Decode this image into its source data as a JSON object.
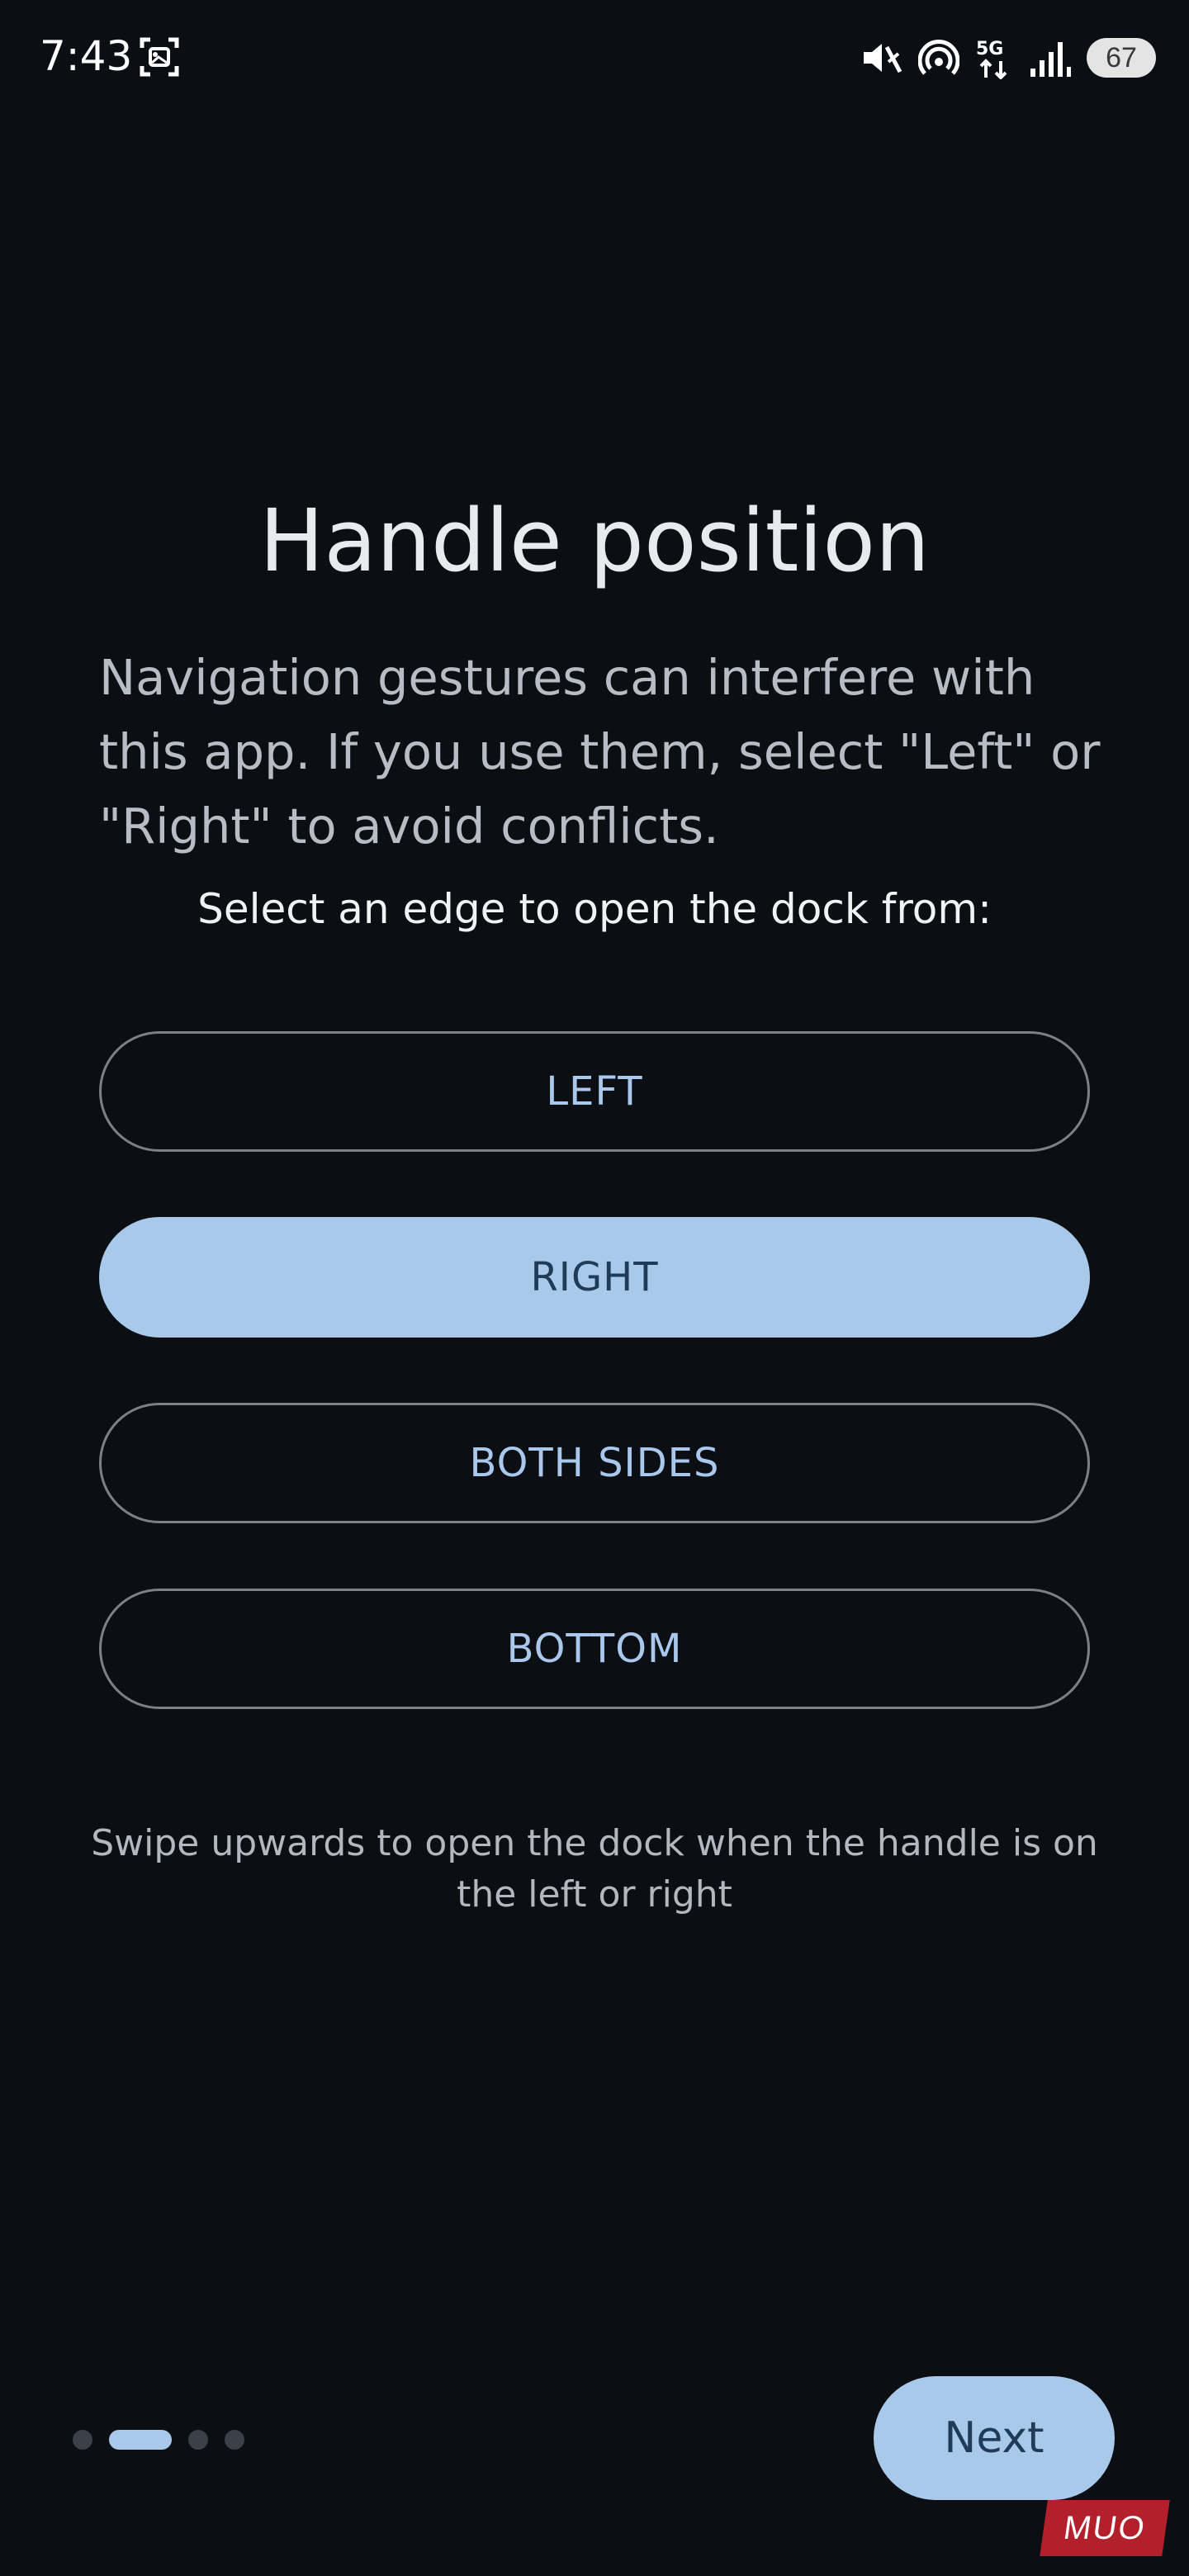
{
  "status_bar": {
    "time": "7:43",
    "battery": "67",
    "icons": [
      "screenshot-icon",
      "mute-icon",
      "hotspot-icon",
      "5g-icon",
      "signal-icon",
      "battery-icon"
    ]
  },
  "title": "Handle position",
  "description": "Navigation gestures can interfere with this app. If you use them, select \"Left\" or \"Right\" to avoid conflicts.",
  "subtitle": "Select an edge to open the dock from:",
  "options": [
    {
      "label": "LEFT",
      "selected": false
    },
    {
      "label": "RIGHT",
      "selected": true
    },
    {
      "label": "BOTH SIDES",
      "selected": false
    },
    {
      "label": "BOTTOM",
      "selected": false
    }
  ],
  "hint": "Swipe upwards to open the dock when the handle is on the left or right",
  "pager": {
    "total": 4,
    "current": 2
  },
  "next_label": "Next",
  "watermark": "MUO",
  "colors": {
    "background": "#0b0e12",
    "accent": "#a9c9ea",
    "accent_text": "#1f3b58",
    "outline": "#7c8087"
  }
}
